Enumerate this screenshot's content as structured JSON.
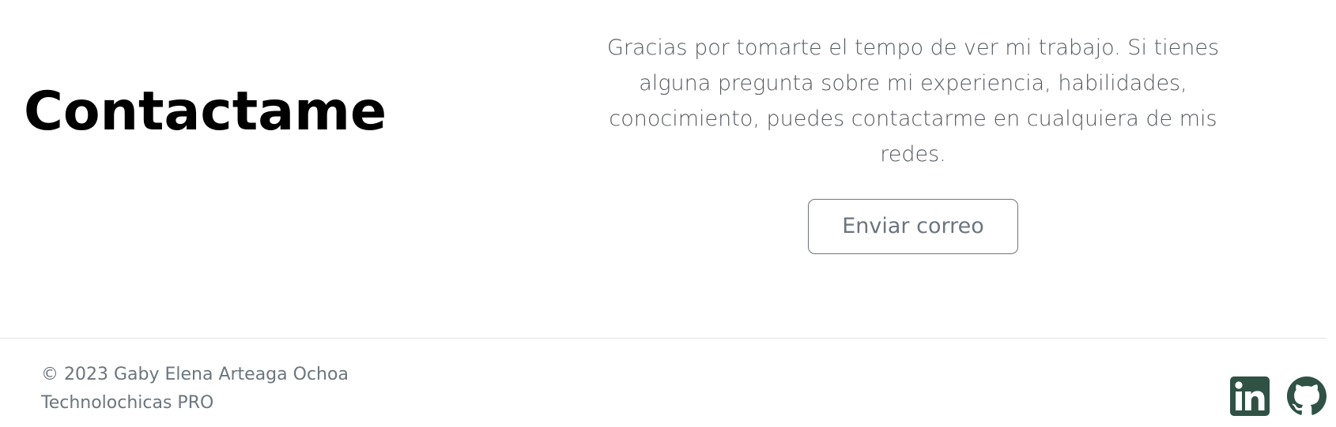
{
  "contact": {
    "heading": "Contactame",
    "message": "Gracias por tomarte el tempo de ver mi trabajo. Si tienes alguna pregunta sobre mi experiencia, habilidades, conocimiento, puedes contactarme en cualquiera de mis redes.",
    "button_label": "Enviar correo"
  },
  "footer": {
    "copyright": "© 2023 Gaby Elena Arteaga Ochoa",
    "organization": "Technolochicas PRO",
    "social": [
      {
        "icon": "linkedin-icon",
        "color": "#2f5245"
      },
      {
        "icon": "github-icon",
        "color": "#2f5245"
      }
    ]
  },
  "colors": {
    "icon_green": "#2f5245",
    "muted_text": "#6c757d",
    "divider": "#dee2e6"
  }
}
